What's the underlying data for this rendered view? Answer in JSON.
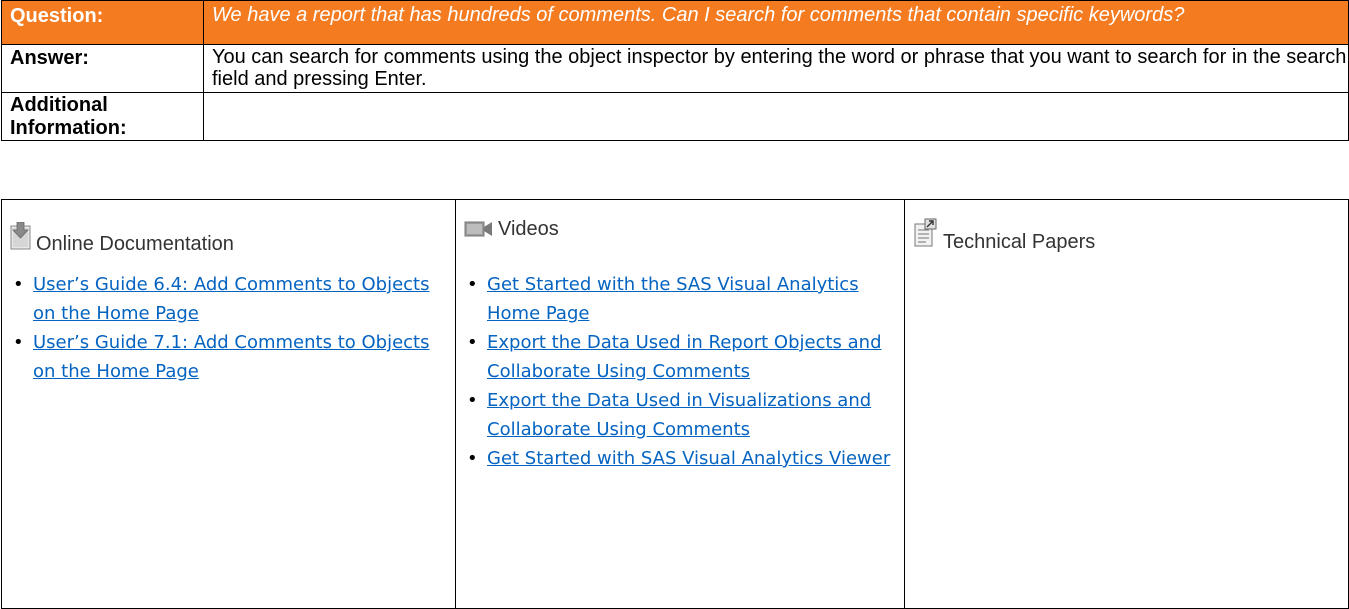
{
  "qa": {
    "question_label": "Question:",
    "question_text": "We have a report that has hundreds of comments.  Can I search for comments that contain specific keywords?",
    "answer_label": "Answer:",
    "answer_text": "You can search for comments using the object inspector by entering the word or phrase that you want to search for in the search field and pressing Enter.",
    "additional_label_line1": "Additional",
    "additional_label_line2": "Information:",
    "additional_text": ""
  },
  "resources": {
    "documentation": {
      "icon": "document-download-icon",
      "title": "Online Documentation",
      "links": [
        "User’s Guide 6.4: Add Comments to Objects on the Home Page",
        "User’s Guide 7.1: Add Comments to Objects on the Home Page"
      ]
    },
    "videos": {
      "icon": "video-camera-icon",
      "title": "Videos",
      "links": [
        "Get Started with the SAS Visual Analytics Home Page",
        "Export the Data Used in Report Objects and Collaborate Using Comments",
        "Export the Data Used in Visualizations and Collaborate Using Comments",
        "Get Started with SAS Visual Analytics Viewer"
      ]
    },
    "papers": {
      "icon": "technical-paper-icon",
      "title": "Technical Papers",
      "links": []
    }
  },
  "colors": {
    "header_background": "#f47b20",
    "link": "#0563c1"
  }
}
